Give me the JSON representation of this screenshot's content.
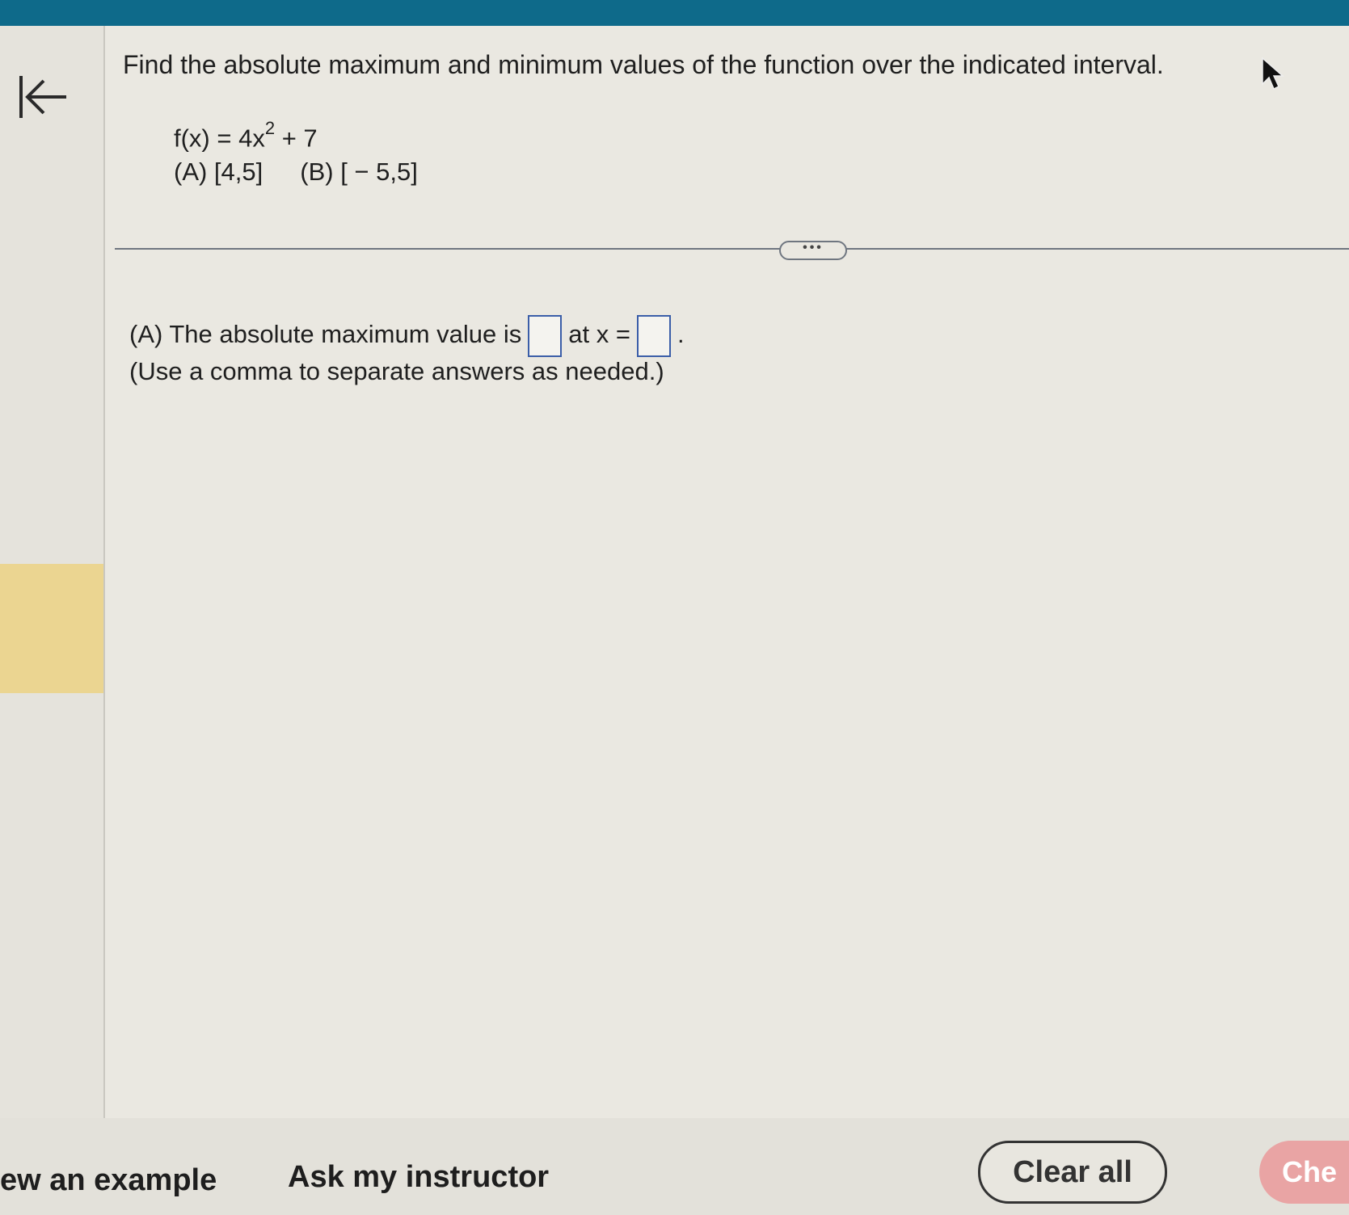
{
  "question": {
    "prompt": "Find the absolute maximum and minimum values of the function over the indicated interval.",
    "function_lhs": "f(x) = 4x",
    "function_exponent": "2",
    "function_rhs": " + 7",
    "interval_a": "(A) [4,5]",
    "interval_b": "(B) [ − 5,5]"
  },
  "answer": {
    "part_a_prefix": "(A) The absolute maximum value is",
    "part_a_middle": "at x =",
    "part_a_suffix": ".",
    "hint": "(Use a comma to separate answers as needed.)"
  },
  "toolbar": {
    "more_label": "•••",
    "view_example": "ew an example",
    "ask_instructor": "Ask my instructor",
    "clear_all": "Clear all",
    "check_answer": "Che"
  },
  "colors": {
    "topbar": "#0e6a8a",
    "highlight": "#ebd591",
    "input_border": "#3b5ea8",
    "check_button": "#e9a4a4"
  }
}
